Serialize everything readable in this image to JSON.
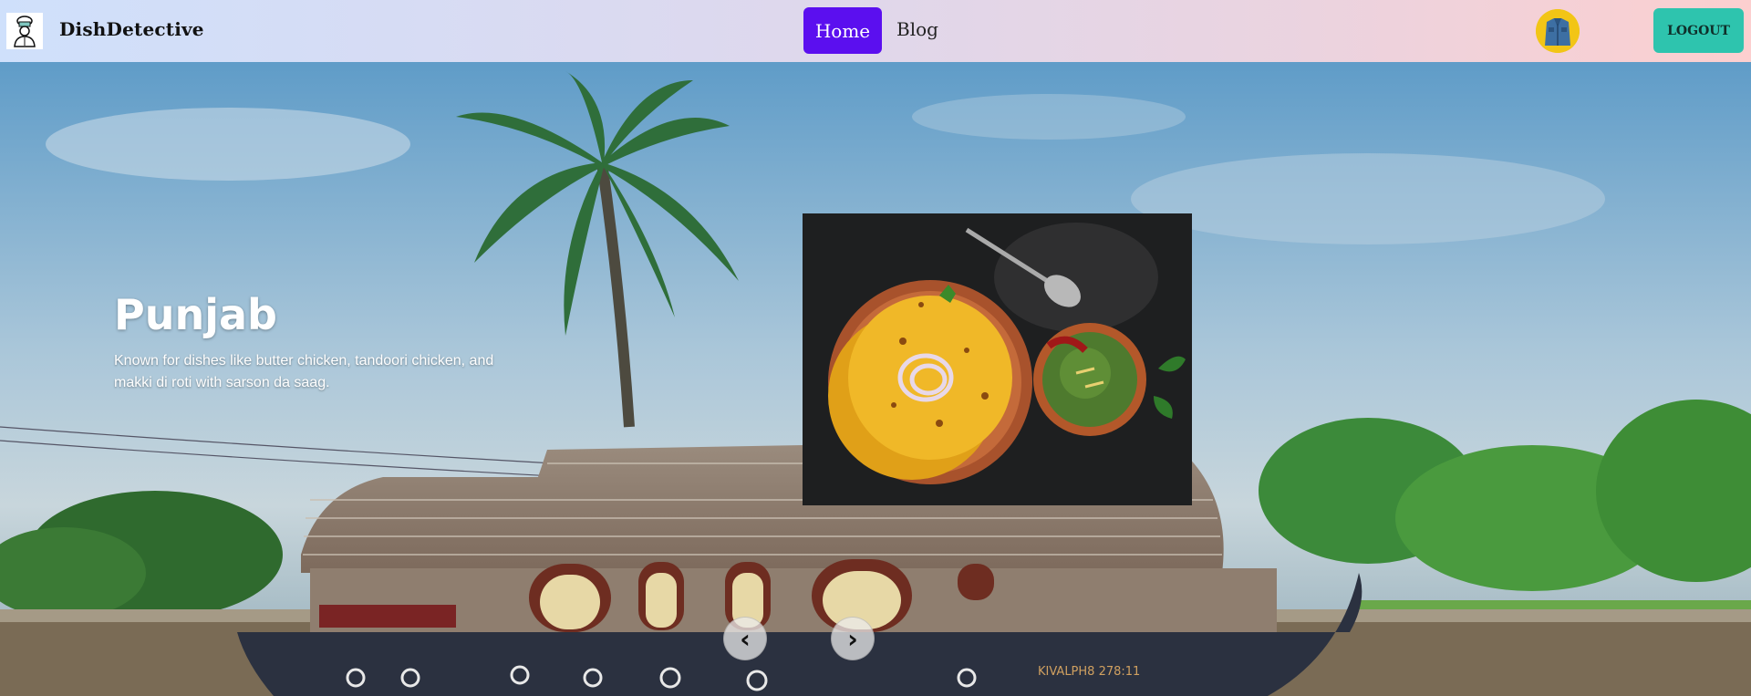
{
  "navbar": {
    "brand": "DishDetective",
    "logo_icon": "chef-logo-icon",
    "links": [
      {
        "label": "Home",
        "active": true
      },
      {
        "label": "Blog",
        "active": false
      }
    ],
    "avatar_icon": "denim-jacket-avatar-icon",
    "logout_label": "LOGOUT",
    "colors": {
      "home_bg": "#5b0fef",
      "logout_bg": "#2ec4ae"
    }
  },
  "carousel": {
    "title": "Punjab",
    "description": "Known for dishes like butter chicken, tandoori chicken, and makki di roti with sarson da saag.",
    "image_icon": "makki-roti-sarson-saag-image",
    "prev_label": "‹",
    "next_label": "›",
    "background_icon": "kerala-houseboat-palm-background"
  }
}
